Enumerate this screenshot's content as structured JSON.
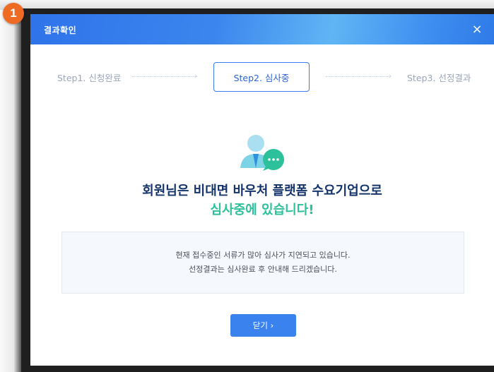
{
  "badge": {
    "number": "1"
  },
  "modal": {
    "title": "결과확인",
    "close_icon": "×"
  },
  "steps": [
    {
      "label": "Step1. 신청완료",
      "state": "done"
    },
    {
      "label": "Step2. 심사중",
      "state": "current"
    },
    {
      "label": "Step3. 선정결과",
      "state": "pending"
    }
  ],
  "step_arrow": "›",
  "illustration": {
    "icon": "user-chat-bubble-icon",
    "colors": [
      "#7fd3e7",
      "#2cc19a",
      "#2f8fe0"
    ]
  },
  "message": {
    "line1": "회원님은 비대면 바우처 플랫폼 수요기업으로",
    "line2": "심사중에 있습니다!"
  },
  "notice": {
    "line1": "현재 접수중인 서류가 많아 심사가 지연되고 있습니다.",
    "line2": "선정결과는 심사완료 후 안내해 드리겠습니다."
  },
  "close_button": {
    "label": "닫기 ›"
  },
  "colors": {
    "accent": "#3a82ee",
    "title_navy": "#15346b",
    "green": "#2cc19a",
    "badge": "#ef6a22"
  }
}
